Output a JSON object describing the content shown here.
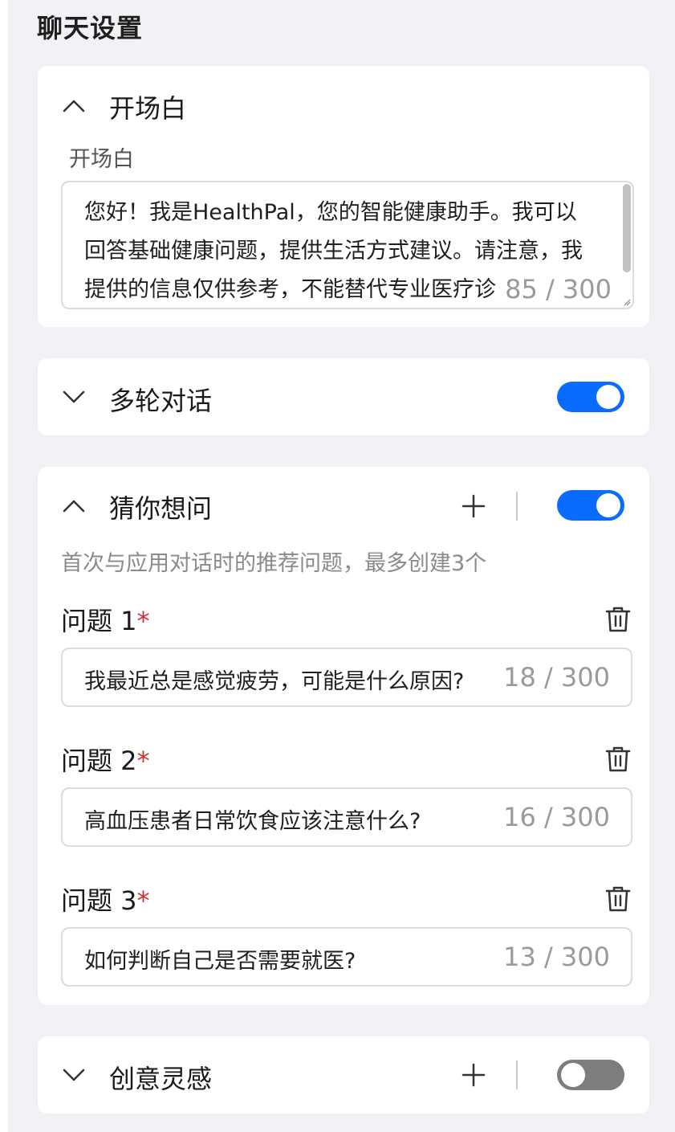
{
  "page_title": "聊天设置",
  "opening": {
    "title": "开场白",
    "field_label": "开场白",
    "text": "您好！我是HealthPal，您的智能健康助手。我可以回答基础健康问题，提供生活方式建议。请注意，我提供的信息仅供参考，不能替代专业医疗诊",
    "counter": "85 / 300"
  },
  "multi_turn": {
    "title": "多轮对话",
    "enabled": true
  },
  "guess": {
    "title": "猜你想问",
    "enabled": true,
    "description": "首次与应用对话时的推荐问题，最多创建3个",
    "required_mark": "*",
    "questions": [
      {
        "label": "问题 1",
        "value": "我最近总是感觉疲劳，可能是什么原因?",
        "counter": "18 / 300"
      },
      {
        "label": "问题 2",
        "value": "高血压患者日常饮食应该注意什么?",
        "counter": "16 / 300"
      },
      {
        "label": "问题 3",
        "value": "如何判断自己是否需要就医?",
        "counter": "13 / 300"
      }
    ]
  },
  "creative": {
    "title": "创意灵感",
    "enabled": false
  },
  "colors": {
    "accent": "#0a6cff",
    "required": "#d0312d",
    "background": "#f0f2f6"
  }
}
